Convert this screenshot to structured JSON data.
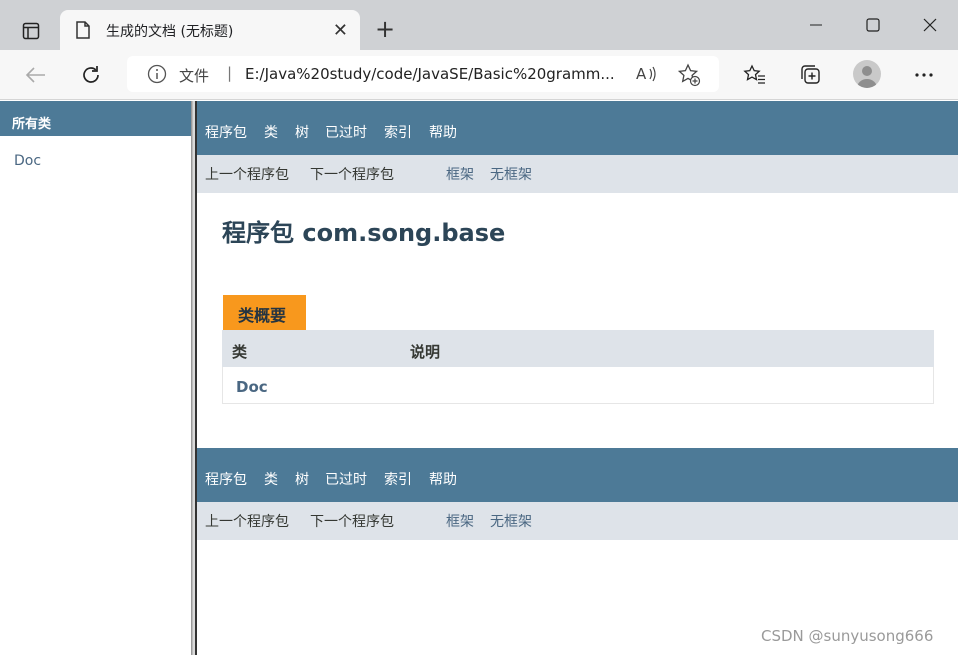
{
  "browser": {
    "tab_title": "生成的文档 (无标题)",
    "address": {
      "scheme_label": "文件",
      "separator": "|",
      "url": "E:/Java%20study/code/JavaSE/Basic%20gramm..."
    }
  },
  "left_frame": {
    "heading": "所有类",
    "items": [
      "Doc"
    ]
  },
  "top_nav": {
    "items": [
      "程序包",
      "类",
      "树",
      "已过时",
      "索引",
      "帮助"
    ]
  },
  "sub_nav": {
    "prev": "上一个程序包",
    "next": "下一个程序包",
    "frames": "框架",
    "no_frames": "无框架"
  },
  "page": {
    "title": "程序包 com.song.base",
    "summary_caption": "类概要",
    "table": {
      "columns": [
        "类",
        "说明"
      ],
      "rows": [
        {
          "class": "Doc",
          "description": ""
        }
      ]
    }
  },
  "bottom_nav": {
    "items": [
      "程序包",
      "类",
      "树",
      "已过时",
      "索引",
      "帮助"
    ],
    "prev": "上一个程序包",
    "next": "下一个程序包",
    "frames": "框架",
    "no_frames": "无框架"
  },
  "watermark": "CSDN @sunyusong666",
  "colors": {
    "nav": "#4d7a97",
    "subnav": "#dee3e9",
    "caption": "#f8981d",
    "link": "#4a6782"
  }
}
